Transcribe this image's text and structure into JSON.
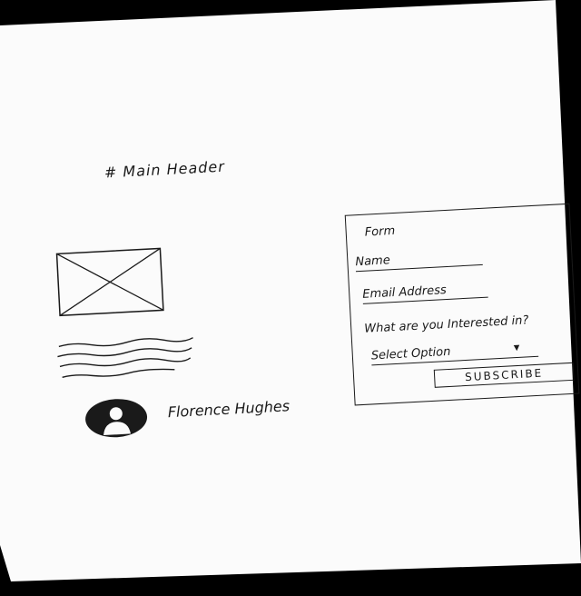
{
  "header": {
    "title": "# Main Header"
  },
  "article": {
    "author_name": "Florence Hughes",
    "image_icon": "image-placeholder-icon",
    "avatar_icon": "user-avatar-icon"
  },
  "form": {
    "title": "Form",
    "name_label": "Name",
    "email_label": "Email Address",
    "interest_label": "What are you Interested in?",
    "select_label": "Select Option",
    "select_icon": "caret-down-icon",
    "submit_label": "SUBSCRIBE"
  }
}
